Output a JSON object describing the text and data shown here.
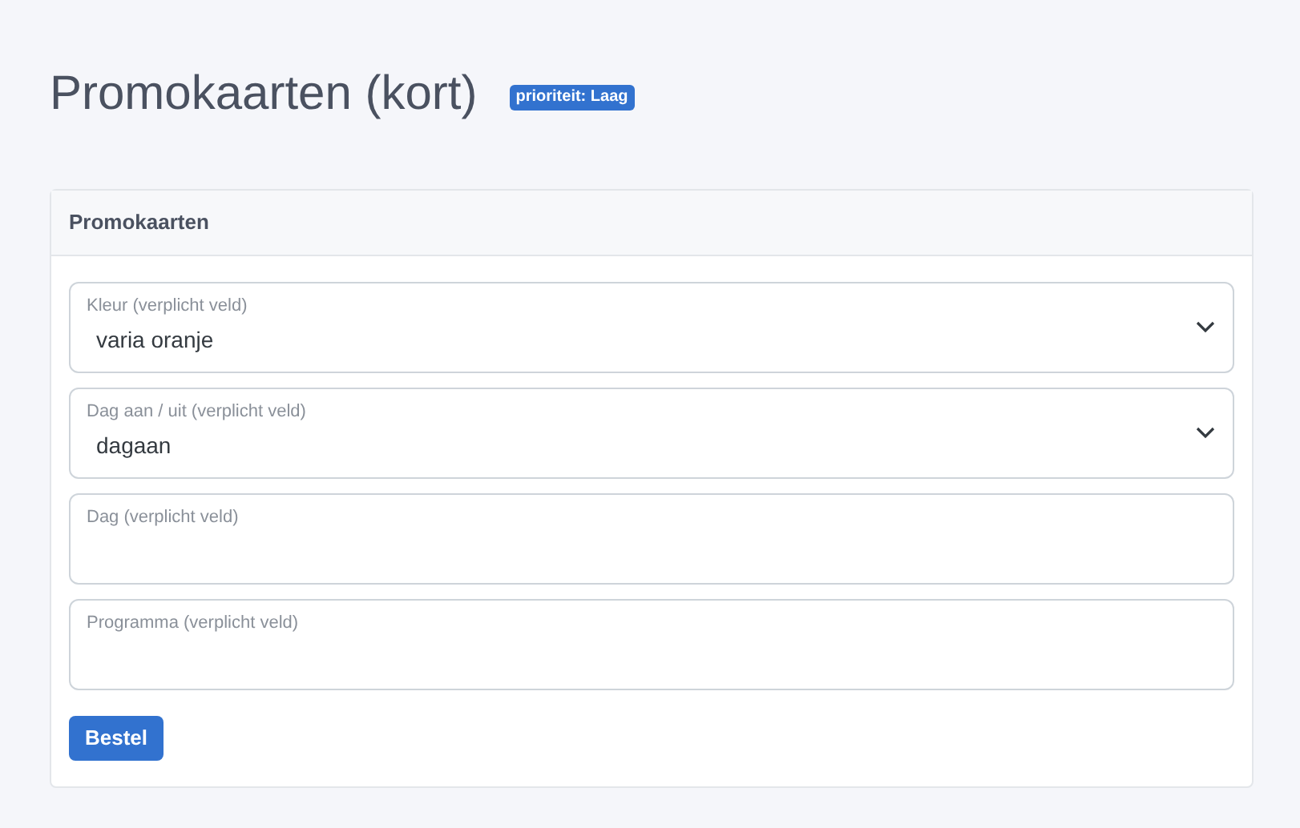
{
  "page_title": "Promokaarten (kort)",
  "priority_badge": "prioriteit: Laag",
  "card": {
    "title": "Promokaarten",
    "fields": [
      {
        "kind": "select",
        "label": "Kleur (verplicht veld)",
        "value": "varia oranje"
      },
      {
        "kind": "select",
        "label": "Dag aan / uit (verplicht veld)",
        "value": "dagaan"
      },
      {
        "kind": "text",
        "label": "Dag (verplicht veld)"
      },
      {
        "kind": "text",
        "label": "Programma (verplicht veld)"
      }
    ],
    "submit_button": "Bestel"
  }
}
